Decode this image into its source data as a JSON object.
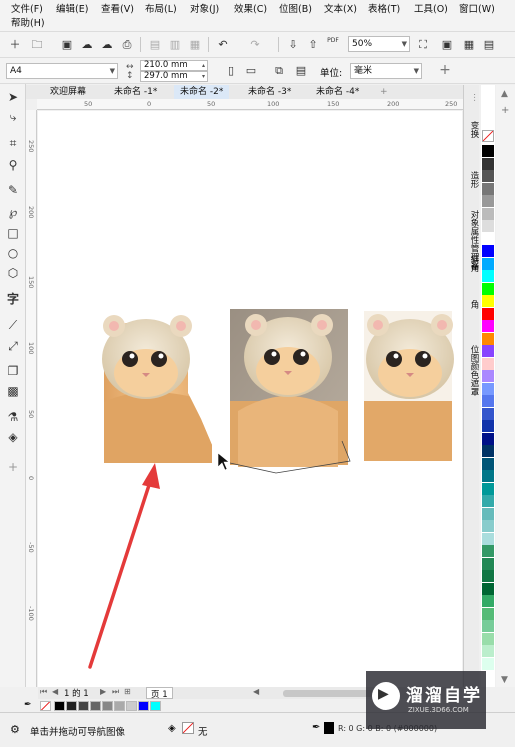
{
  "menu": {
    "row1": [
      "文件(F)",
      "编辑(E)",
      "查看(V)",
      "布局(L)",
      "对象(J)",
      "效果(C)",
      "位图(B)",
      "文本(X)",
      "表格(T)",
      "工具(O)",
      "窗口(W)"
    ],
    "row2": [
      "帮助(H)"
    ]
  },
  "toolbar": {
    "zoom": "50%",
    "pdf_label": "PDF"
  },
  "propbar": {
    "page_size": "A4",
    "width": "210.0 mm",
    "height": "297.0 mm",
    "unit_label": "单位:",
    "unit_value": "毫米"
  },
  "tabs": [
    {
      "label": "欢迎屏幕",
      "active": false
    },
    {
      "label": "未命名 -1*",
      "active": false
    },
    {
      "label": "未命名 -2*",
      "active": true
    },
    {
      "label": "未命名 -3*",
      "active": false
    },
    {
      "label": "未命名 -4*",
      "active": false
    }
  ],
  "ruler": {
    "h": [
      "50",
      "0",
      "50",
      "100",
      "150",
      "200",
      "250"
    ],
    "v": [
      "250",
      "200",
      "150",
      "100",
      "50",
      "0",
      "-50",
      "-100"
    ]
  },
  "dock": {
    "tabs": [
      "变换",
      "造形",
      "对象属性管理器",
      "斜角",
      "角",
      "位图颜色遮罩"
    ]
  },
  "pagenav": {
    "counter": "1 的 1",
    "page_tab": "页 1"
  },
  "status": {
    "hint": "单击并拖动可导航图像",
    "fill_label": "无",
    "color_readout": "R: 0 G: 0 B: 0 (#000000)"
  },
  "watermark": {
    "brand": "溜溜自学",
    "url": "ZIXUE.3D66.COM"
  },
  "colors": {
    "arrow": "#e43a3a",
    "accent": "#0078d7"
  },
  "palette": [
    "#000000",
    "#333333",
    "#555555",
    "#777777",
    "#999999",
    "#bbbbbb",
    "#dddddd",
    "#ffffff",
    "#0000ff",
    "#00aaff",
    "#00ffff",
    "#00ff00",
    "#ffff00",
    "#ff0000",
    "#ff00ff",
    "#ff8800",
    "#8844ff",
    "#ffcccc",
    "#aa88ff",
    "#7799ff",
    "#5577ee",
    "#3355cc",
    "#1133aa",
    "#001188",
    "#003366",
    "#005577",
    "#007788",
    "#009999",
    "#33aaaa",
    "#66bbbb",
    "#88cccc",
    "#aadddd",
    "#339966",
    "#228855",
    "#117744",
    "#006633",
    "#33aa66",
    "#55bb77",
    "#77cc99",
    "#99ddaa",
    "#bbeecc",
    "#ddffee"
  ],
  "colorbar": [
    "#ffffff",
    "#000000",
    "#222222",
    "#444444",
    "#666666",
    "#888888",
    "#aaaaaa",
    "#cccccc",
    "#0000ff",
    "#00ffff"
  ]
}
